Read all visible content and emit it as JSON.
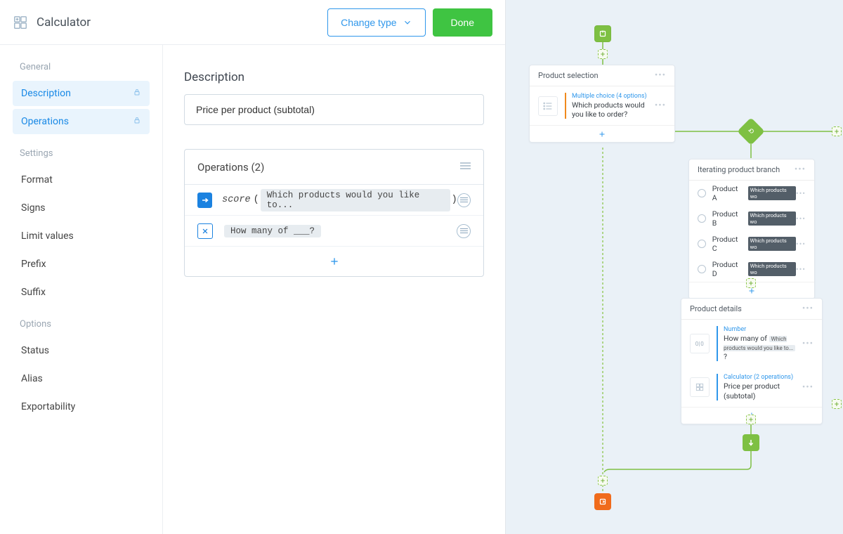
{
  "header": {
    "title": "Calculator",
    "change_type": "Change type",
    "done": "Done"
  },
  "sidebar": {
    "groups": [
      {
        "title": "General",
        "items": [
          {
            "label": "Description",
            "active": true,
            "lock": true
          },
          {
            "label": "Operations",
            "active": true,
            "lock": true
          }
        ]
      },
      {
        "title": "Settings",
        "items": [
          {
            "label": "Format"
          },
          {
            "label": "Signs"
          },
          {
            "label": "Limit values"
          },
          {
            "label": "Prefix"
          },
          {
            "label": "Suffix"
          }
        ]
      },
      {
        "title": "Options",
        "items": [
          {
            "label": "Status"
          },
          {
            "label": "Alias"
          },
          {
            "label": "Exportability"
          }
        ]
      }
    ]
  },
  "content": {
    "description_label": "Description",
    "description_value": "Price per product (subtotal)",
    "operations_title": "Operations (2)",
    "ops": [
      {
        "kind": "arrow",
        "fn": "score",
        "chip": "Which products would you like to..."
      },
      {
        "kind": "mult",
        "chip": "How many of ___?"
      }
    ]
  },
  "flow": {
    "product_selection": {
      "title": "Product selection",
      "item_type": "Multiple choice (4 options)",
      "item_title": "Which products would you like to order?"
    },
    "branch": {
      "title": "Iterating product branch",
      "options": [
        {
          "label": "Product A",
          "chip": "Which products wo"
        },
        {
          "label": "Product B",
          "chip": "Which products wo"
        },
        {
          "label": "Product C",
          "chip": "Which products wo"
        },
        {
          "label": "Product D",
          "chip": "Which products wo"
        }
      ]
    },
    "product_details": {
      "title": "Product details",
      "rows": [
        {
          "type": "Number",
          "title_prefix": "How many of ",
          "chip": "Which products would you like to...",
          "title_suffix": " ?"
        },
        {
          "type": "Calculator (2 operations)",
          "title": "Price per product (subtotal)"
        }
      ]
    }
  }
}
